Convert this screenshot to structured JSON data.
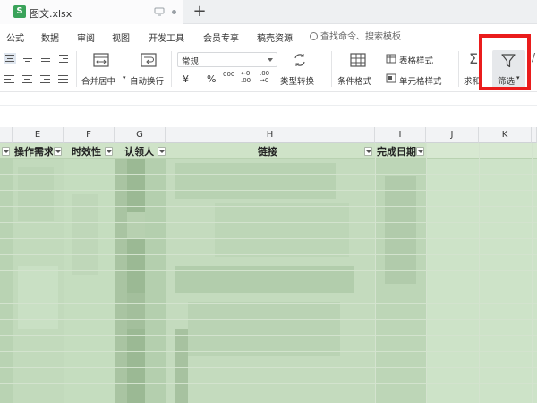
{
  "tabbar": {
    "doc_title": "图文.xlsx",
    "doc_icon_letter": "S"
  },
  "menu": {
    "items": [
      "公式",
      "数据",
      "审阅",
      "视图",
      "开发工具",
      "会员专享",
      "稿壳资源"
    ],
    "search_placeholder": "查找命令、搜索模板"
  },
  "ribbon": {
    "merge_label": "合并居中",
    "wrap_label": "自动换行",
    "number_format": "常规",
    "currency_symbol": "¥",
    "percent_symbol": "%",
    "thousands_symbol": "000",
    "inc_decimal": "←0 .00",
    "dec_decimal": ".00 →0",
    "type_convert_label": "类型转换",
    "cond_format_label": "条件格式",
    "table_style_label": "表格样式",
    "cell_style_label": "单元格样式",
    "sum_label": "求和",
    "filter_label": "筛选"
  },
  "grid": {
    "columns": [
      "E",
      "F",
      "G",
      "H",
      "I",
      "J",
      "K"
    ],
    "headers": [
      "操作需求",
      "时效性",
      "认领人",
      "链接",
      "完成日期"
    ],
    "colors": {
      "header_row": "#cfe3c8",
      "body": "#c6dcc1",
      "highlight_red": "#ea1c1c",
      "brand_green": "#3aa35a"
    }
  }
}
